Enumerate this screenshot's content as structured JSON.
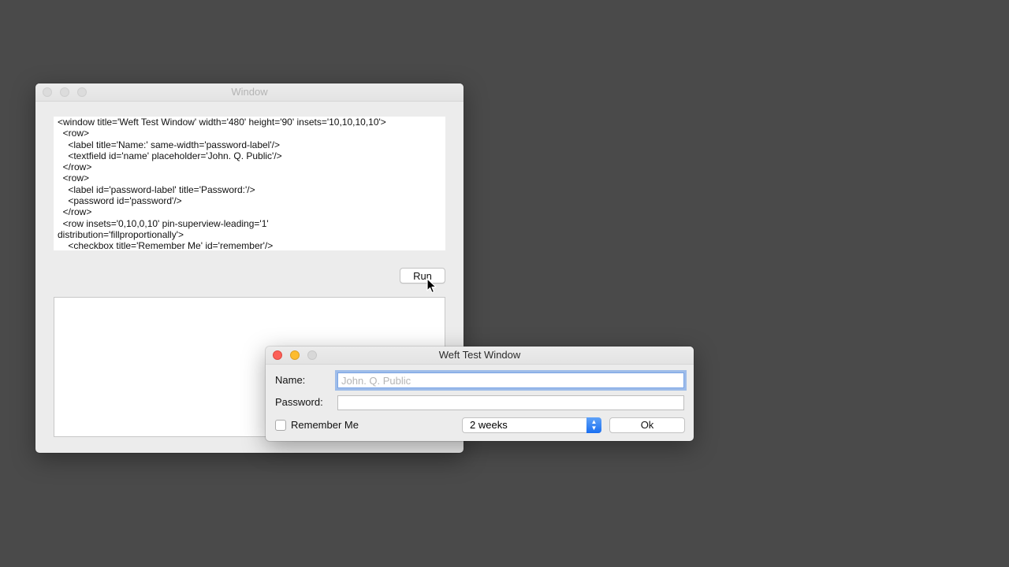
{
  "editor_window": {
    "title": "Window",
    "code": "<window title='Weft Test Window' width='480' height='90' insets='10,10,10,10'>\n  <row>\n    <label title='Name:' same-width='password-label'/>\n    <textfield id='name' placeholder='John. Q. Public'/>\n  </row>\n  <row>\n    <label id='password-label' title='Password:'/>\n    <password id='password'/>\n  </row>\n  <row insets='0,10,0,10' pin-superview-leading='1'\ndistribution='fillproportionally'>\n    <checkbox title='Remember Me' id='remember'/>",
    "run_label": "Run"
  },
  "test_window": {
    "title": "Weft Test Window",
    "name_label": "Name:",
    "name_placeholder": "John. Q. Public",
    "password_label": "Password:",
    "remember_label": "Remember Me",
    "duration_value": "2 weeks",
    "ok_label": "Ok"
  },
  "icons": {
    "cursor": "arrow-cursor-icon",
    "popup_arrows": "updown-chevron-icon"
  },
  "colors": {
    "desktop": "#4a4a4a",
    "close": "#fc5f57",
    "minimize": "#fdbc2e",
    "focus_ring": "#5e95e7",
    "popup_accent": "#1a6ff1"
  }
}
